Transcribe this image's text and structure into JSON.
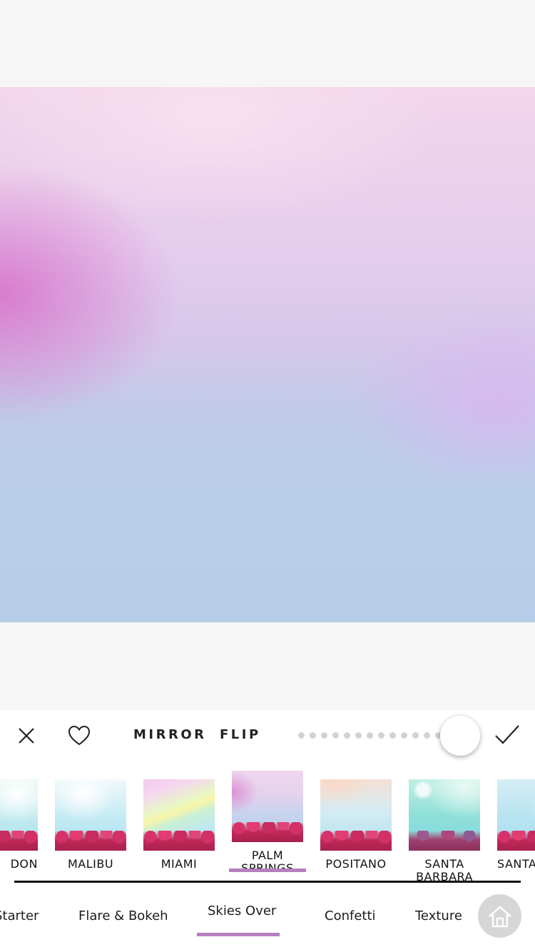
{
  "toolbar": {
    "mirror_label": "MIRROR",
    "flip_label": "FLIP",
    "slider_value_fraction": 1.0
  },
  "presets": {
    "items": [
      {
        "label": "DON",
        "selected": false
      },
      {
        "label": "MALIBU",
        "selected": false
      },
      {
        "label": "MIAMI",
        "selected": false
      },
      {
        "label": "PALM\nSPRINGS",
        "selected": true
      },
      {
        "label": "POSITANO",
        "selected": false
      },
      {
        "label": "SANTA\nBARBARA",
        "selected": false
      },
      {
        "label": "SANTA",
        "selected": false
      }
    ]
  },
  "categories": {
    "items": [
      {
        "label": "Starter",
        "selected": false
      },
      {
        "label": "Flare & Bokeh",
        "selected": false
      },
      {
        "label": "Skies Over",
        "selected": true
      },
      {
        "label": "Confetti",
        "selected": false
      },
      {
        "label": "Texture",
        "selected": false
      }
    ]
  },
  "colors": {
    "accent": "#b57fbf",
    "home_button_bg": "#d6d6d6"
  },
  "icons": [
    "close-icon",
    "heart-icon",
    "checkmark-icon",
    "home-icon"
  ]
}
